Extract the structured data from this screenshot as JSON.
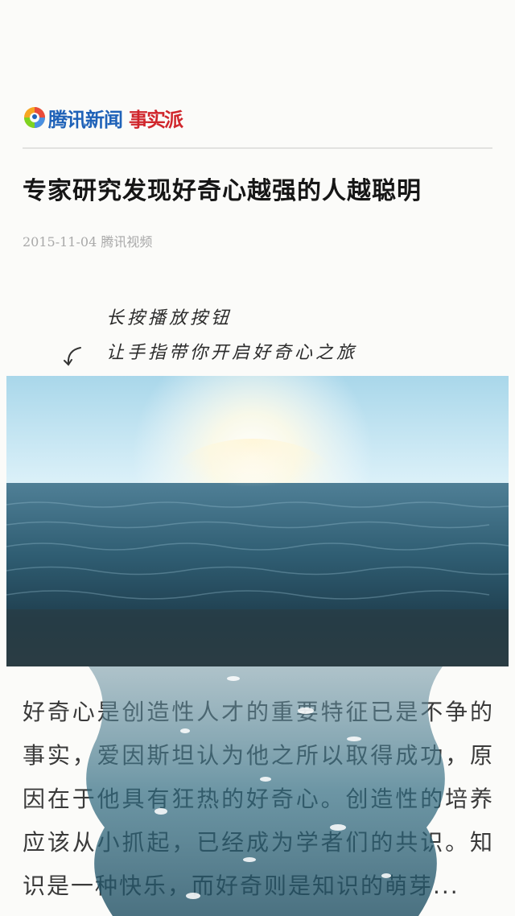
{
  "header": {
    "brand": "腾讯新闻",
    "column": "事实派",
    "logo_icon": "tencent-news-logo-icon"
  },
  "article": {
    "title": "专家研究发现好奇心越强的人越聪明",
    "date": "2015-11-04",
    "source": "腾讯视频",
    "hint_line1": "长按播放按钮",
    "hint_line2": "让手指带你开启好奇心之旅",
    "body": "好奇心是创造性人才的重要特征已是不争的事实，爱因斯坦认为他之所以取得成功，原因在于他具有狂热的好奇心。创造性的培养应该从小抓起，已经成为学者们的共识。知识是一种快乐，而好奇则是知识的萌芽..."
  },
  "colors": {
    "brand_blue": "#1f62b8",
    "brand_red": "#d0262c",
    "sky": "#bfe6f5",
    "sea": "#2c5a70"
  }
}
